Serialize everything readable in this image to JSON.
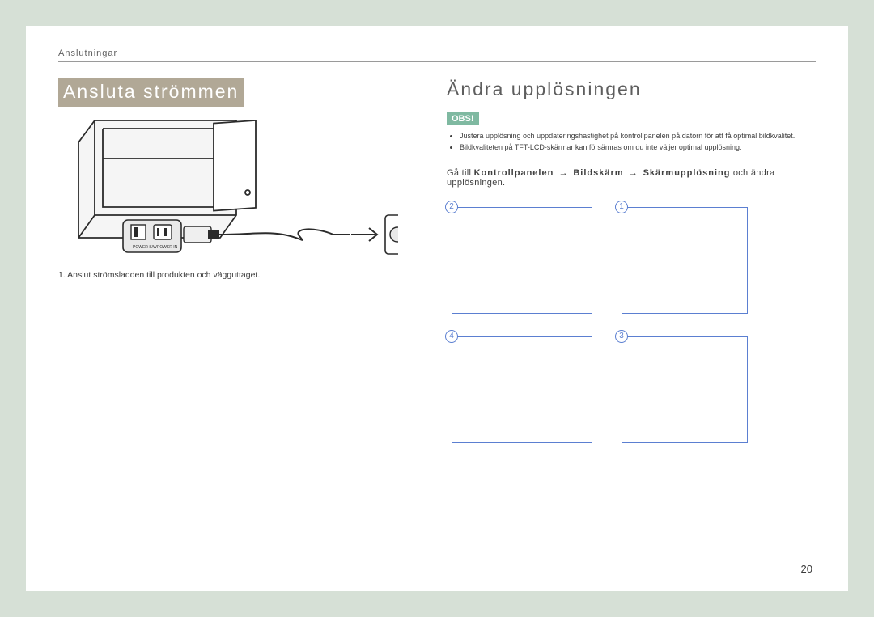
{
  "chapter": "Anslutningar",
  "left": {
    "heading": "Ansluta strömmen",
    "step1": "1. Anslut strömsladden till produkten och vägguttaget."
  },
  "right": {
    "heading": "Ändra upplösningen",
    "obs_label": "OBS!",
    "bullets": [
      "Justera upplösning och uppdateringshastighet på kontrollpanelen på datorn för att få optimal bildkvalitet.",
      "Bildkvaliteten på TFT-LCD-skärmar kan försämras om du inte väljer optimal upplösning."
    ],
    "path_prefix": "Gå till",
    "path_items": [
      "Kontrollpanelen",
      "Bildskärm",
      "Skärmupplösning"
    ],
    "path_suffix": "och ändra upplösningen.",
    "arrow": "→",
    "screens": [
      "2",
      "1",
      "4",
      "3"
    ]
  },
  "page_number": "20"
}
